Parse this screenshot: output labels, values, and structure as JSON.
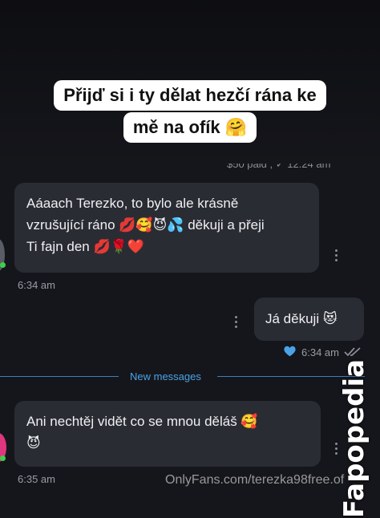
{
  "banner": {
    "line1": "Přijď si i ty dělat hezčí rána ke",
    "line2": "mě na ofík 🤗"
  },
  "cut_timestamp": "$50 paid , ✓ 12:24 am",
  "messages": [
    {
      "direction": "incoming",
      "lines": [
        "Aáaach Terezko, to bylo ale krásně",
        "vzrušující ráno 💋🥰😈💦 děkuji a přeji",
        "Ti fajn den 💋🌹❤️"
      ],
      "time": "6:34 am"
    },
    {
      "direction": "outgoing",
      "lines": [
        "Já děkuji 😻"
      ],
      "time": "6:34 am",
      "liked": true,
      "read": true
    },
    {
      "direction": "incoming",
      "lines": [
        "Ani nechtěj vidět co se mnou děláš 🥰",
        "😈"
      ],
      "time": "6:35 am"
    }
  ],
  "divider_label": "New messages",
  "watermarks": {
    "side": "Fapopedia",
    "bottom": "OnlyFans.com/terezka98free.of"
  },
  "colors": {
    "background": "#15161b",
    "bubble": "#2a2c34",
    "accent": "#4aa3e6",
    "online": "#3ecf4a"
  }
}
